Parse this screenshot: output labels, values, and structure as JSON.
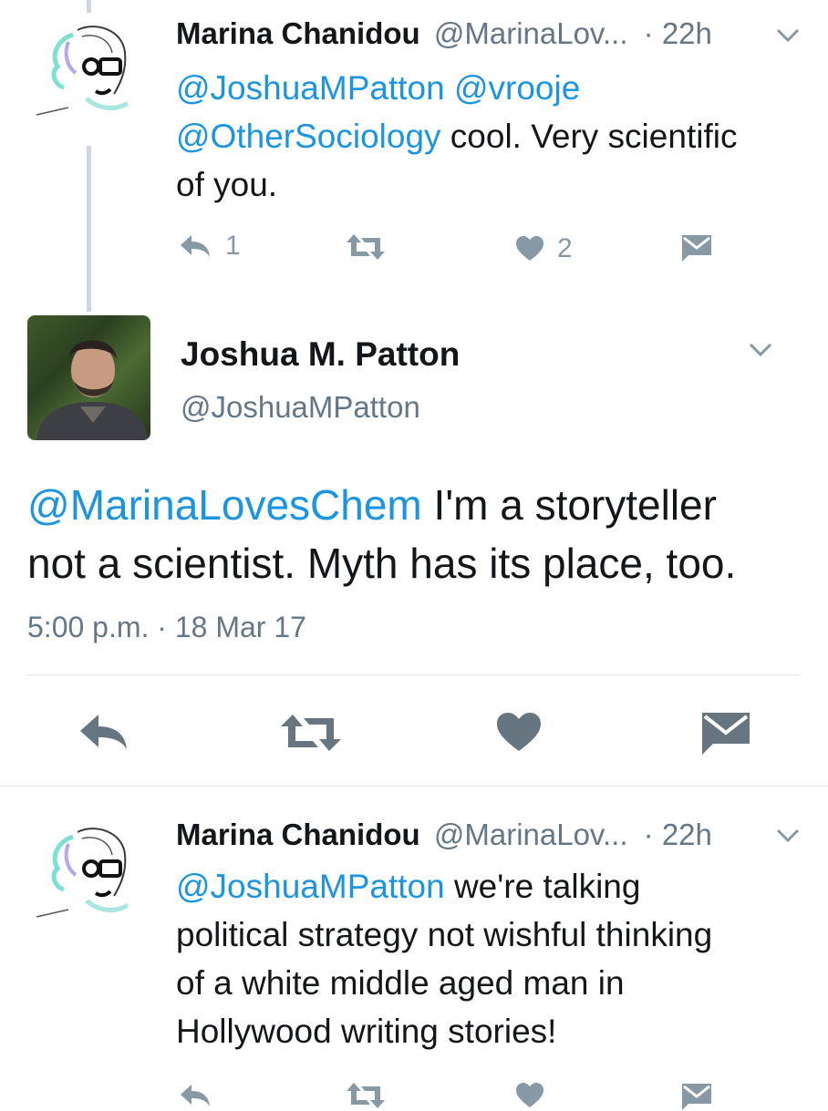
{
  "tweets": [
    {
      "name": "Marina Chanidou",
      "handle": "@MarinaLov...",
      "time": "· 22h",
      "text_parts": [
        {
          "t": "@JoshuaMPatton @vrooje",
          "m": true
        },
        {
          "t": "@OtherSociology",
          "m": true
        },
        {
          "t": " cool. Very scientific",
          "m": false
        },
        {
          "t": "of you.",
          "m": false
        }
      ],
      "reply_count": "1",
      "like_count": "2"
    },
    {
      "name": "Marina Chanidou",
      "handle": "@MarinaLov...",
      "time": "· 22h",
      "mention": "@JoshuaMPatton",
      "line1_rest": " we're talking",
      "line2": "political strategy not wishful thinking",
      "line3": "of a white middle aged man in",
      "line4": "Hollywood writing stories!"
    }
  ],
  "main_tweet": {
    "name": "Joshua M. Patton",
    "handle": "@JoshuaMPatton",
    "mention": "@MarinaLovesChem",
    "line1_rest": " I'm a storyteller",
    "line2": "not a scientist. Myth has its place, too.",
    "timestamp": "5:00 p.m. · 18 Mar 17"
  },
  "icons": {
    "reply": "reply-icon",
    "retweet": "retweet-icon",
    "like": "heart-icon",
    "dm": "envelope-icon",
    "menu": "chevron-down-icon"
  },
  "colors": {
    "mention": "#1b95e0",
    "secondary": "#657786",
    "icon": "#8899a6",
    "icon_dark": "#66757f",
    "thread_line": "#ccd6dd"
  }
}
